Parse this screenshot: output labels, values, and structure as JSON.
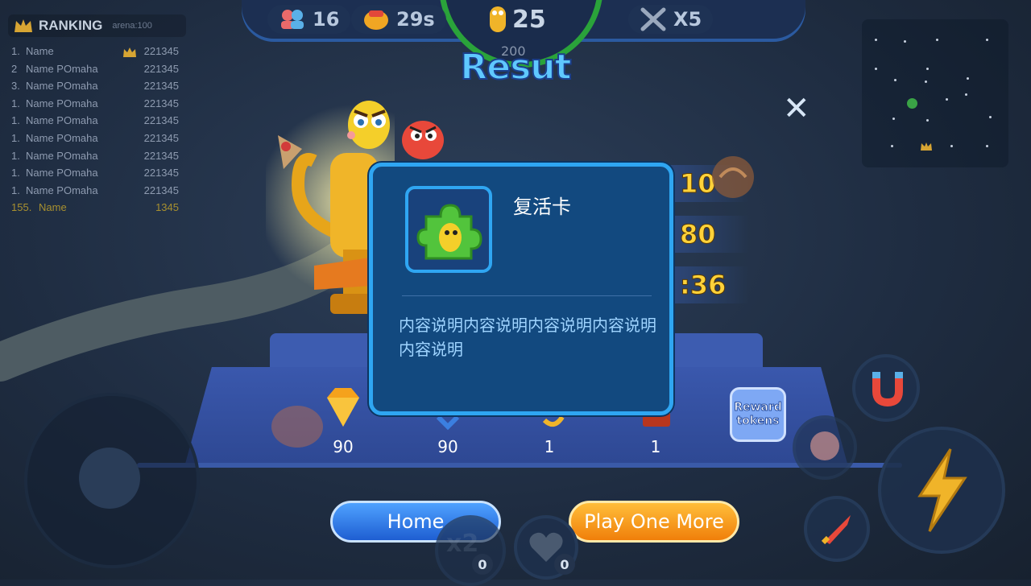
{
  "hud": {
    "players": "16",
    "time": "29s",
    "length": "25",
    "length_target": "200",
    "multiplier": "X5"
  },
  "ranking": {
    "title": "RANKING",
    "arena": "arena:100",
    "rows": [
      {
        "pos": "1.",
        "name": "Name",
        "score": "221345"
      },
      {
        "pos": "2",
        "name": "Name POmaha",
        "score": "221345"
      },
      {
        "pos": "3.",
        "name": "Name POmaha",
        "score": "221345"
      },
      {
        "pos": "1.",
        "name": "Name POmaha",
        "score": "221345"
      },
      {
        "pos": "1.",
        "name": "Name POmaha",
        "score": "221345"
      },
      {
        "pos": "1.",
        "name": "Name POmaha",
        "score": "221345"
      },
      {
        "pos": "1.",
        "name": "Name POmaha",
        "score": "221345"
      },
      {
        "pos": "1.",
        "name": "Name POmaha",
        "score": "221345"
      },
      {
        "pos": "1.",
        "name": "Name POmaha",
        "score": "221345"
      }
    ],
    "me": {
      "pos": "155.",
      "name": "Name",
      "score": "1345"
    }
  },
  "result": {
    "title": "Resut",
    "stats": [
      "10",
      "80",
      ":36"
    ]
  },
  "rewards": [
    {
      "icon": "diamond-icon",
      "value": "90"
    },
    {
      "icon": "blue-gem-icon",
      "value": "90"
    },
    {
      "icon": "gold-item-icon",
      "value": "1"
    },
    {
      "icon": "chest-icon",
      "value": "1"
    }
  ],
  "reward_tokens_label": "Reward tokens",
  "popup": {
    "title": "复活卡",
    "description": "内容说明内容说明内容说明内容说明内容说明"
  },
  "buttons": {
    "home": "Home",
    "play_more": "Play One More"
  },
  "counts": {
    "x2": "0",
    "heart": "0"
  },
  "colors": {
    "accent_blue": "#2fa6f2",
    "gold": "#ffd23a",
    "orange": "#f07f0a"
  }
}
